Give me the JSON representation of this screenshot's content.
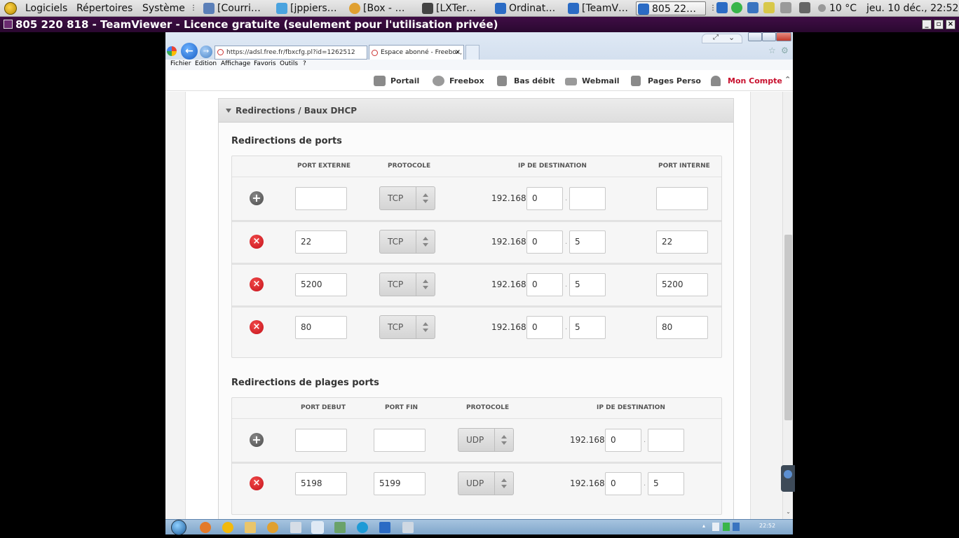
{
  "top_panel": {
    "menu": [
      "Logiciels",
      "Répertoires",
      "Système"
    ],
    "tasks": [
      {
        "label": "[Courri…",
        "color": "#5b7fb8"
      },
      {
        "label": "[jppiers…",
        "color": "#4aa3df"
      },
      {
        "label": "[Box - …",
        "color": "#e0a030"
      },
      {
        "label": "[LXTer…",
        "color": "#444444"
      },
      {
        "label": "Ordinat…",
        "color": "#2b6bc4"
      },
      {
        "label": "[TeamV…",
        "color": "#2b6bc4"
      },
      {
        "label": "805 22…",
        "color": "#2b6bc4"
      }
    ],
    "weather": "10 °C",
    "clock": "jeu. 10 déc., 22:52"
  },
  "teamviewer": {
    "title": "805 220 818 - TeamViewer - Licence gratuite (seulement pour l'utilisation privée)"
  },
  "browser": {
    "address": "https://adsl.free.fr/fbxcfg.pl?id=1262512",
    "tab_title": "Espace abonné - Freebox, l…",
    "menu": [
      "Fichier",
      "Edition",
      "Affichage",
      "Favoris",
      "Outils",
      "?"
    ]
  },
  "free_nav": [
    "Portail",
    "Freebox",
    "Bas débit",
    "Webmail",
    "Pages Perso",
    "Mon Compte"
  ],
  "panel": {
    "title": "Redirections / Baux DHCP"
  },
  "ports": {
    "title": "Redirections de ports",
    "headers": [
      "PORT EXTERNE",
      "PROTOCOLE",
      "IP DE DESTINATION",
      "PORT INTERNE"
    ],
    "ip_prefix": "192.168.",
    "rows": [
      {
        "action": "add",
        "ext": "",
        "proto": "TCP",
        "ip3": "0",
        "ip4": "",
        "int": ""
      },
      {
        "action": "delete",
        "ext": "22",
        "proto": "TCP",
        "ip3": "0",
        "ip4": "5",
        "int": "22"
      },
      {
        "action": "delete",
        "ext": "5200",
        "proto": "TCP",
        "ip3": "0",
        "ip4": "5",
        "int": "5200"
      },
      {
        "action": "delete",
        "ext": "80",
        "proto": "TCP",
        "ip3": "0",
        "ip4": "5",
        "int": "80"
      }
    ]
  },
  "ranges": {
    "title": "Redirections de plages ports",
    "headers": [
      "PORT DEBUT",
      "PORT FIN",
      "PROTOCOLE",
      "IP DE DESTINATION"
    ],
    "ip_prefix": "192.168.",
    "rows": [
      {
        "action": "add",
        "start": "",
        "end": "",
        "proto": "UDP",
        "ip3": "0",
        "ip4": ""
      },
      {
        "action": "delete",
        "start": "5198",
        "end": "5199",
        "proto": "UDP",
        "ip3": "0",
        "ip4": "5"
      }
    ]
  },
  "win_taskbar": {
    "clock": "22:52"
  },
  "colors": {
    "account_red": "#c8102e",
    "delete_red": "#d21f26",
    "teamviewer_bar": "#3a0c40"
  }
}
